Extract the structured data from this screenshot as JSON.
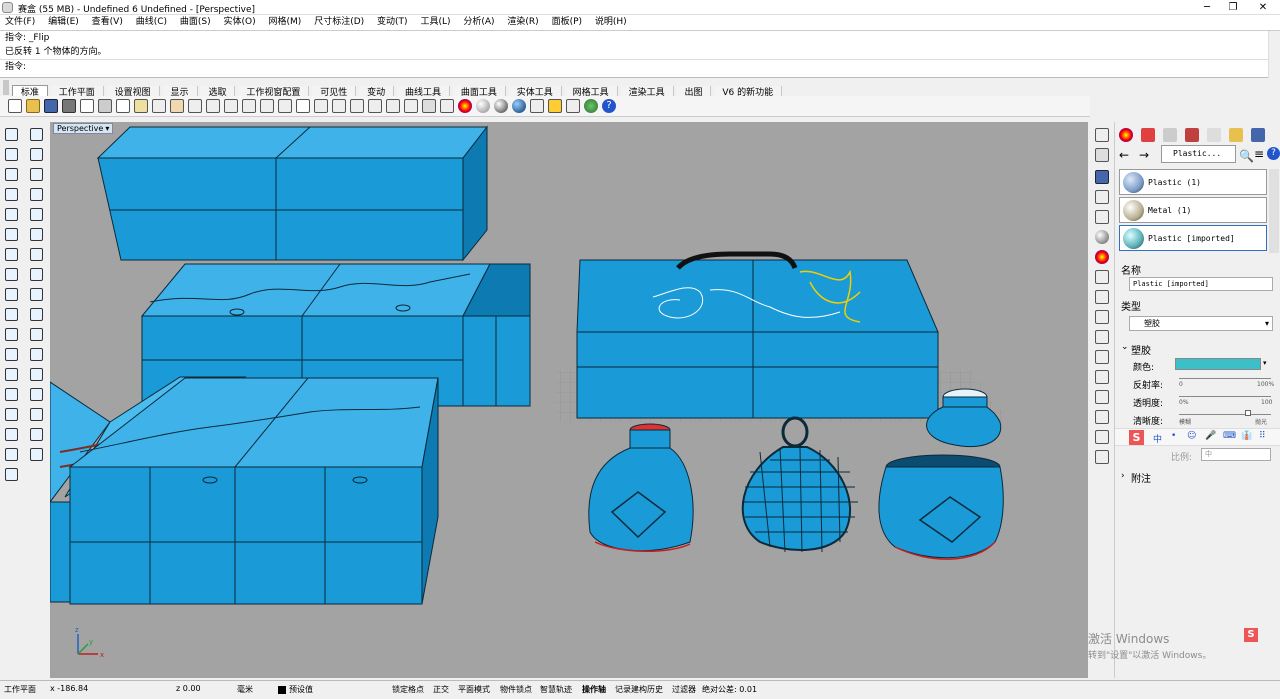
{
  "window": {
    "title": "赛盒 (55 MB) - Undefined 6 Undefined - [Perspective]",
    "minimize": "─",
    "maximize": "❐",
    "close": "✕"
  },
  "menu": [
    "文件(F)",
    "编辑(E)",
    "查看(V)",
    "曲线(C)",
    "曲面(S)",
    "实体(O)",
    "网格(M)",
    "尺寸标注(D)",
    "变动(T)",
    "工具(L)",
    "分析(A)",
    "渲染(R)",
    "面板(P)",
    "说明(H)"
  ],
  "command": {
    "history_line1": "指令: _Flip",
    "history_line2": "已反转 1 个物体的方向。",
    "prompt": "指令:"
  },
  "tabs": [
    "标准",
    "工作平面",
    "设置视图",
    "显示",
    "选取",
    "工作视窗配置",
    "可见性",
    "变动",
    "曲线工具",
    "曲面工具",
    "实体工具",
    "网格工具",
    "渲染工具",
    "出图",
    "V6 的新功能"
  ],
  "active_tab": "标准",
  "viewport": {
    "label": "Perspective",
    "background": "#a3a3a3",
    "object_color": "#1a9ad6",
    "edge_color": "#0b2a3a",
    "axis_x": "x",
    "axis_y": "y",
    "axis_z": "z"
  },
  "panel": {
    "search_value": "Plastic...",
    "materials": [
      {
        "name": "Plastic (1)",
        "ball": "#7a9cc8"
      },
      {
        "name": "Metal (1)",
        "ball": "#b8b090"
      },
      {
        "name": "Plastic [imported]",
        "ball": "#5ab0b8"
      }
    ],
    "name_label": "名称",
    "name_value": "Plastic [imported]",
    "type_label": "类型",
    "type_value": "塑胶",
    "section_label": "塑胶",
    "color_label": "颜色:",
    "color_value": "#3cc0c8",
    "reflect_label": "反射率:",
    "reflect_min": "0",
    "reflect_max": "100%",
    "transp_label": "透明度:",
    "transp_min": "0%",
    "transp_max": "100",
    "clarity_label": "清晰度:",
    "clarity_min": "模糊",
    "clarity_max": "抛光",
    "ratio_label": "比例:",
    "ratio_value": "中",
    "notes_label": "附注"
  },
  "ime_bar": [
    "中",
    "•",
    "☺",
    "🎤",
    "⌨",
    "👔",
    "⠿"
  ],
  "watermark": {
    "line1": "激活 Windows",
    "line2": "转到\"设置\"以激活 Windows。"
  },
  "status": {
    "cplane": "工作平面",
    "x": "x -186.84",
    "z": "z 0.00",
    "units": "毫米",
    "layer": "预设值",
    "snap": "锁定格点",
    "ortho": "正交",
    "planar": "平面模式",
    "osnap": "物件锁点",
    "smarttrack": "智慧轨迹",
    "gumball": "操作轴",
    "history": "记录建构历史",
    "filter": "过滤器",
    "tolerance": "绝对公差: 0.01"
  }
}
